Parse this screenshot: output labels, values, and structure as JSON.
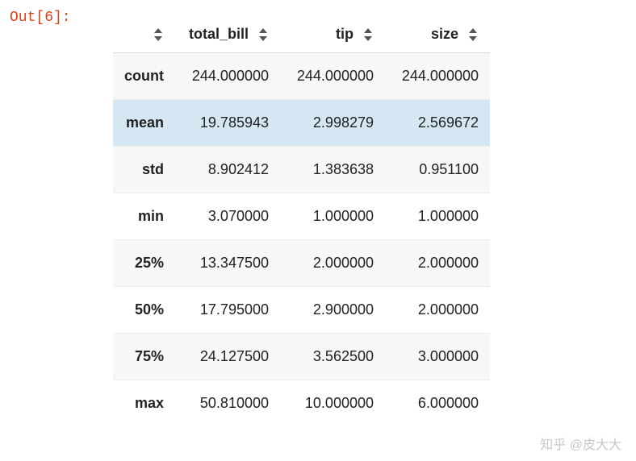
{
  "out_label": "Out[6]:",
  "columns": [
    "total_bill",
    "tip",
    "size"
  ],
  "rows": [
    {
      "label": "count",
      "cells": [
        "244.000000",
        "244.000000",
        "244.000000"
      ],
      "highlight": false
    },
    {
      "label": "mean",
      "cells": [
        "19.785943",
        "2.998279",
        "2.569672"
      ],
      "highlight": true
    },
    {
      "label": "std",
      "cells": [
        "8.902412",
        "1.383638",
        "0.951100"
      ],
      "highlight": false
    },
    {
      "label": "min",
      "cells": [
        "3.070000",
        "1.000000",
        "1.000000"
      ],
      "highlight": false
    },
    {
      "label": "25%",
      "cells": [
        "13.347500",
        "2.000000",
        "2.000000"
      ],
      "highlight": false
    },
    {
      "label": "50%",
      "cells": [
        "17.795000",
        "2.900000",
        "2.000000"
      ],
      "highlight": false
    },
    {
      "label": "75%",
      "cells": [
        "24.127500",
        "3.562500",
        "3.000000"
      ],
      "highlight": false
    },
    {
      "label": "max",
      "cells": [
        "50.810000",
        "10.000000",
        "6.000000"
      ],
      "highlight": false
    }
  ],
  "watermark": "知乎 @皮大大"
}
